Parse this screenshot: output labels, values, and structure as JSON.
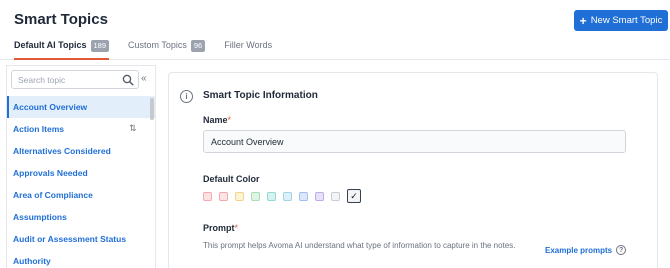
{
  "header": {
    "title": "Smart Topics",
    "new_button_label": "New Smart Topic"
  },
  "tabs": [
    {
      "label": "Default AI Topics",
      "count": "189"
    },
    {
      "label": "Custom Topics",
      "count": "96"
    },
    {
      "label": "Filler Words",
      "count": ""
    }
  ],
  "sidebar": {
    "search_placeholder": "Search topic",
    "items": [
      {
        "label": "Account Overview"
      },
      {
        "label": "Action Items"
      },
      {
        "label": "Alternatives Considered"
      },
      {
        "label": "Approvals Needed"
      },
      {
        "label": "Area of Compliance"
      },
      {
        "label": "Assumptions"
      },
      {
        "label": "Audit or Assessment Status"
      },
      {
        "label": "Authority"
      }
    ]
  },
  "detail": {
    "section_title": "Smart Topic Information",
    "name_label": "Name",
    "required_mark": "*",
    "name_value": "Account Overview",
    "color_label": "Default Color",
    "colors": [
      {
        "fill": "#fde2e4",
        "border": "#f4a9b1"
      },
      {
        "fill": "#fde4e6",
        "border": "#f2a6ae"
      },
      {
        "fill": "#fdf3d5",
        "border": "#f0d48a"
      },
      {
        "fill": "#def5e6",
        "border": "#a9dcb9"
      },
      {
        "fill": "#d5f3ef",
        "border": "#95d9cf"
      },
      {
        "fill": "#dcf1f8",
        "border": "#9fd3e6"
      },
      {
        "fill": "#dce7fb",
        "border": "#a3bdf0"
      },
      {
        "fill": "#e6e2fa",
        "border": "#b9aeea"
      },
      {
        "fill": "#f3f4f6",
        "border": "#c9ccd1"
      }
    ],
    "selected_color_mark": "✓",
    "prompt_label": "Prompt",
    "prompt_help": "This prompt helps Avoma AI understand what type of information to capture in the notes.",
    "example_prompts_label": "Example prompts"
  },
  "accent_color": "#1f6fd6",
  "tab_underline_color": "#e05a3a"
}
